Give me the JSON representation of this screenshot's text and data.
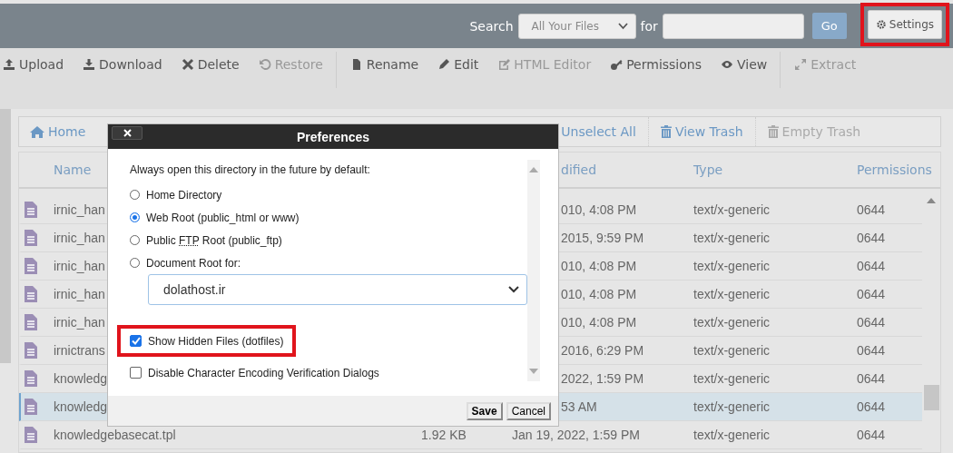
{
  "top_bar": {
    "search_label": "Search",
    "search_scope": "All Your Files",
    "for_label": "for",
    "go_button": "Go",
    "settings_button": {
      "label": "Settings",
      "highlighted": true
    }
  },
  "toolbar": [
    {
      "label": "Upload",
      "disabled": false
    },
    {
      "label": "Download",
      "disabled": false
    },
    {
      "label": "Delete",
      "disabled": false
    },
    {
      "label": "Restore",
      "disabled": true
    },
    {
      "label": "Rename",
      "disabled": false
    },
    {
      "label": "Edit",
      "disabled": false
    },
    {
      "label": "HTML Editor",
      "disabled": true
    },
    {
      "label": "Permissions",
      "disabled": false
    },
    {
      "label": "View",
      "disabled": false
    },
    {
      "label": "Extract",
      "disabled": true
    }
  ],
  "breadcrumb": {
    "home": "Home",
    "actions": [
      {
        "label": "Unselect All",
        "disabled": false
      },
      {
        "label": "View Trash",
        "disabled": false
      },
      {
        "label": "Empty Trash",
        "disabled": true
      }
    ]
  },
  "table": {
    "columns": [
      "Name",
      "dified",
      "Type",
      "Permissions"
    ],
    "rows": [
      {
        "kind": "partial",
        "name": "irnic_han",
        "modified": "010, 4:08 PM",
        "type": "text/x-generic",
        "permissions": "0644",
        "selected": false
      },
      {
        "kind": "partial",
        "name": "irnic_han",
        "modified": "2015, 9:59 PM",
        "type": "text/x-generic",
        "permissions": "0644",
        "selected": false
      },
      {
        "kind": "partial",
        "name": "irnic_han",
        "modified": "010, 4:08 PM",
        "type": "text/x-generic",
        "permissions": "0644",
        "selected": false
      },
      {
        "kind": "partial",
        "name": "irnic_han",
        "modified": "010, 4:08 PM",
        "type": "text/x-generic",
        "permissions": "0644",
        "selected": false
      },
      {
        "kind": "partial",
        "name": "irnic_han",
        "modified": "010, 4:08 PM",
        "type": "text/x-generic",
        "permissions": "0644",
        "selected": false
      },
      {
        "kind": "partial",
        "name": "irnictrans",
        "modified": "2016, 6:29 PM",
        "type": "text/x-generic",
        "permissions": "0644",
        "selected": false
      },
      {
        "kind": "partial",
        "name": "knowledg",
        "modified": "2022, 1:59 PM",
        "type": "text/x-generic",
        "permissions": "0644",
        "selected": false
      },
      {
        "kind": "partial",
        "name": "knowledg",
        "modified": "53 AM",
        "type": "text/x-generic",
        "permissions": "0644",
        "selected": true
      },
      {
        "kind": "full",
        "name": "knowledgebasecat.tpl",
        "size": "1.92 KB",
        "modified": "Jan 19, 2022, 1:59 PM",
        "type": "text/x-generic",
        "permissions": "0644",
        "selected": false
      }
    ]
  },
  "dialog": {
    "title": "Preferences",
    "prompt": "Always open this directory in the future by default:",
    "options": [
      {
        "label": "Home Directory",
        "selected": false
      },
      {
        "label": "Web Root (public_html or www)",
        "selected": true
      },
      {
        "label_before": "Public ",
        "abbr": "FTP",
        "label_after": " Root (public_ftp)",
        "selected": false
      },
      {
        "label": "Document Root for:",
        "selected": false,
        "domain_select": "dolathost.ir"
      }
    ],
    "checkboxes": [
      {
        "label": "Show Hidden Files (dotfiles)",
        "checked": true,
        "highlighted": true
      },
      {
        "label": "Disable Character Encoding Verification Dialogs",
        "checked": false,
        "highlighted": false
      }
    ],
    "buttons": [
      {
        "label": "Save",
        "primary": true
      },
      {
        "label": "Cancel",
        "primary": false
      }
    ]
  }
}
